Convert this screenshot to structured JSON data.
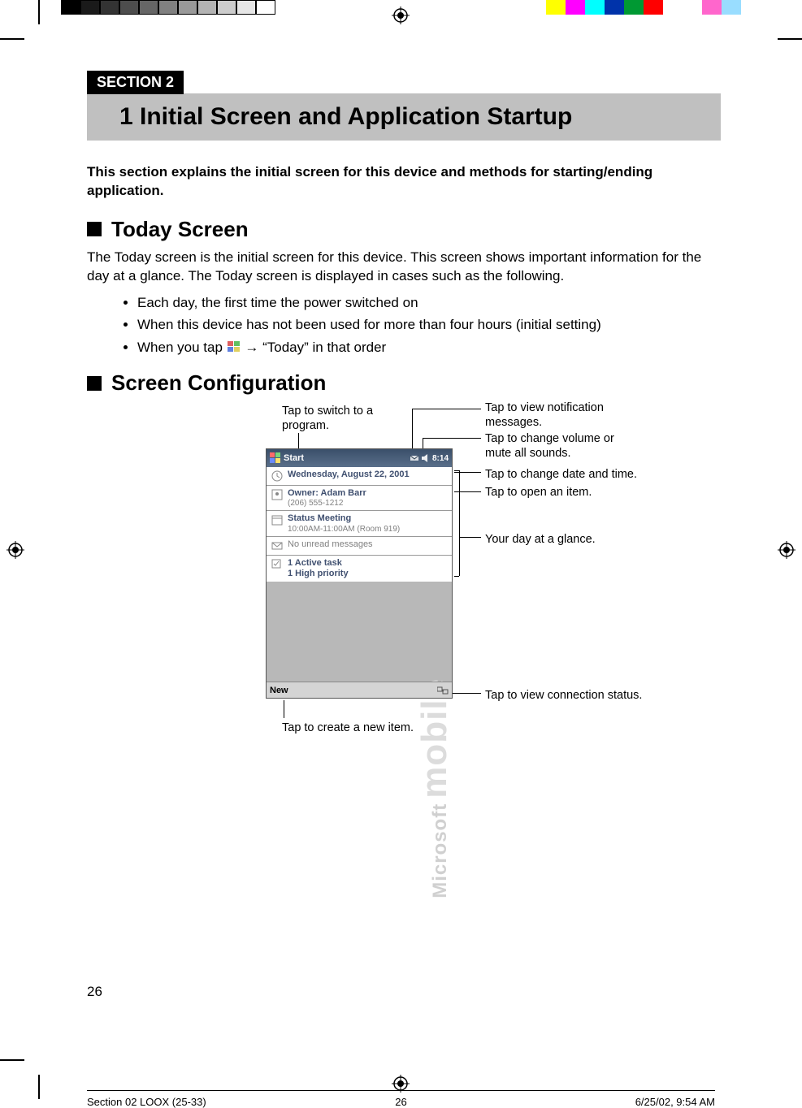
{
  "colorbar_left": [
    "#000000",
    "#1a1a1a",
    "#333333",
    "#4d4d4d",
    "#666666",
    "#808080",
    "#999999",
    "#b3b3b3",
    "#cccccc",
    "#e6e6e6",
    "#ffffff"
  ],
  "colorbar_right": [
    "#ffff00",
    "#ff00ff",
    "#00ffff",
    "#0033aa",
    "#009933",
    "#ff0000",
    "#ffffff",
    "#ffffff",
    "#ff66cc",
    "#99ddff"
  ],
  "section_tab": "SECTION 2",
  "chapter_title": "1  Initial Screen and Application Startup",
  "intro": "This section explains the initial screen for this device and methods for starting/ending application.",
  "today_heading": "Today Screen",
  "today_para": "The Today screen is the initial screen for this device. This screen shows important information for the day at a glance. The Today screen is displayed in cases such as the following.",
  "bullets": [
    "Each day, the first time the power switched on",
    "When this device has not been used for more than four hours (initial setting)"
  ],
  "bullet3_pre": "When you tap ",
  "bullet3_arrow": "→",
  "bullet3_post": " “Today” in that order",
  "config_heading": "Screen Configuration",
  "callouts": {
    "switch_program": "Tap to switch to a program.",
    "notifications": "Tap to view notification messages.",
    "volume": "Tap to change volume or mute all sounds.",
    "date_time": "Tap to change date and time.",
    "open_item": "Tap to open an item.",
    "glance": "Your day at a glance.",
    "connection": "Tap to view connection status.",
    "new_item": "Tap to create a new item."
  },
  "pda": {
    "start": "Start",
    "time": "8:14",
    "date": "Wednesday, August 22, 2001",
    "owner": "Owner: Adam Barr",
    "owner_sub": "(206) 555-1212",
    "meeting": "Status Meeting",
    "meeting_sub": "10:00AM-11:00AM (Room 919)",
    "inbox": "No unread messages",
    "tasks_l1": "1 Active task",
    "tasks_l2": "1 High priority",
    "new": "New",
    "wm1": "Microsoft",
    "wm2": "mobile"
  },
  "page_number": "26",
  "footer": {
    "left": "Section 02 LOOX (25-33)",
    "center": "26",
    "right": "6/25/02, 9:54 AM"
  }
}
